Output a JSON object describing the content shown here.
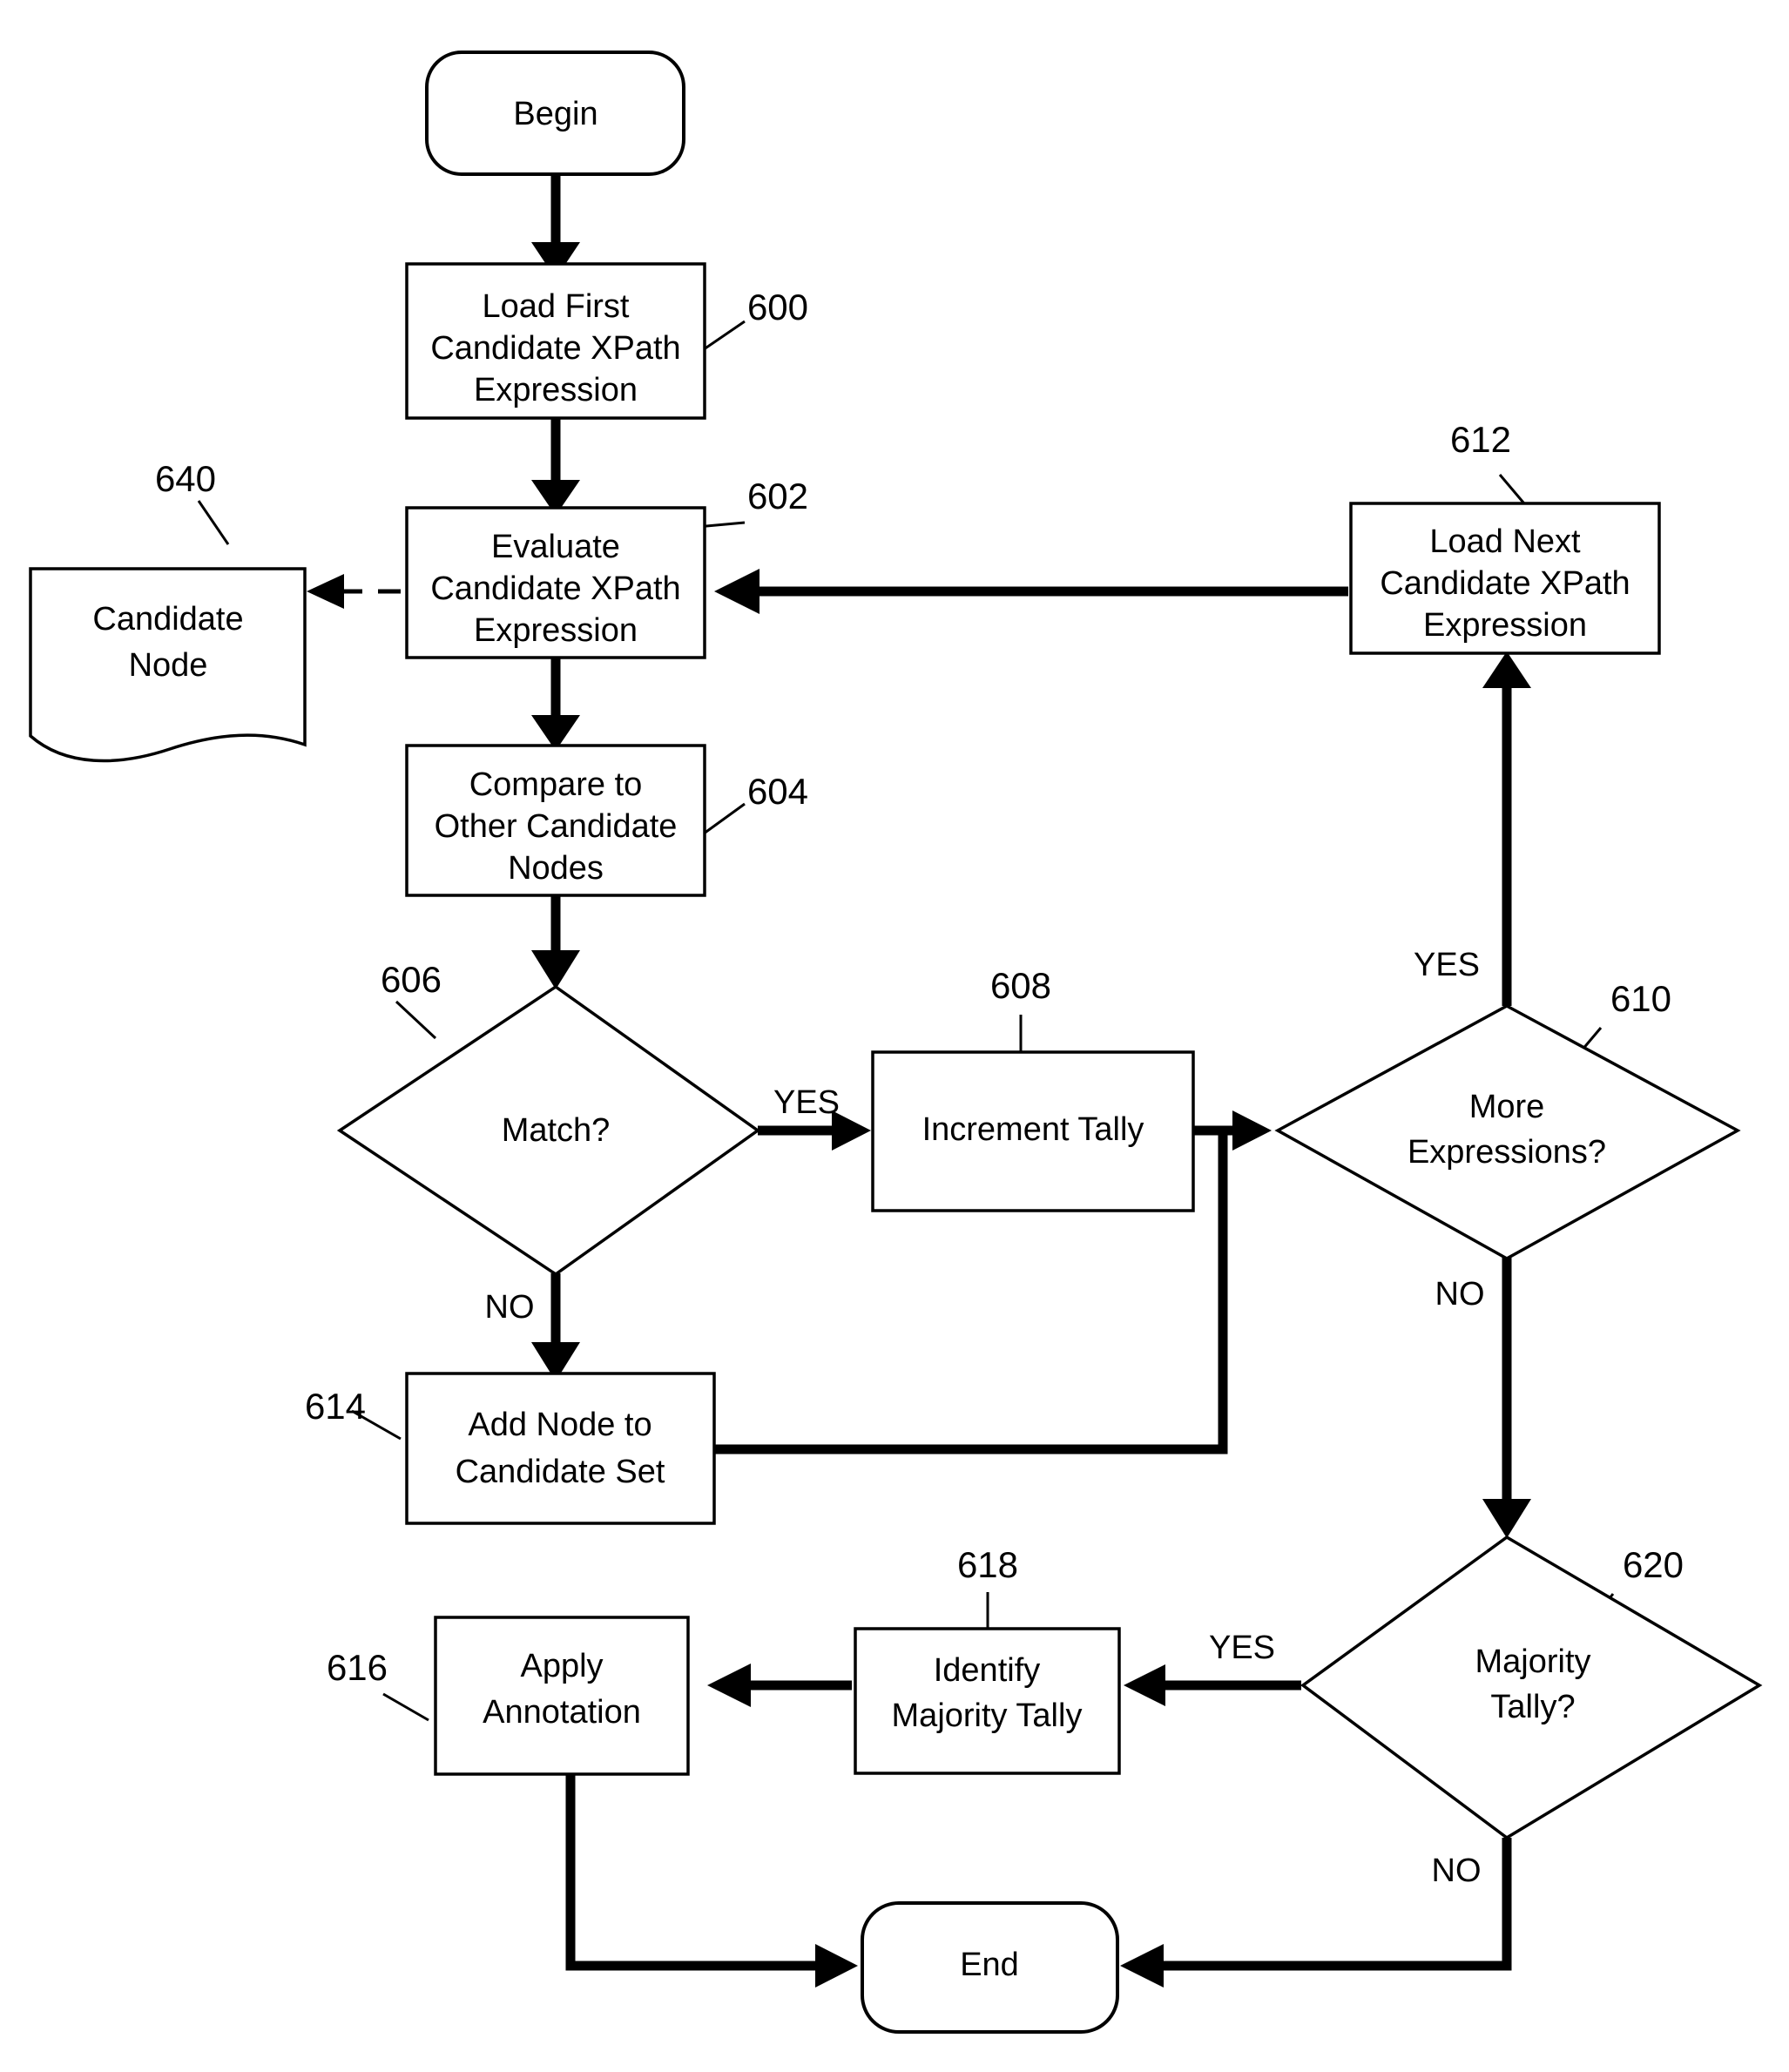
{
  "diagram": {
    "type": "flowchart",
    "title": "Candidate XPath Expression Evaluation Flowchart",
    "nodes": [
      {
        "id": "begin",
        "label": "Begin",
        "shape": "terminator",
        "ref": ""
      },
      {
        "id": "n600",
        "label_lines": [
          "Load First",
          "Candidate XPath",
          "Expression"
        ],
        "shape": "process",
        "ref": "600"
      },
      {
        "id": "n602",
        "label_lines": [
          "Evaluate",
          "Candidate XPath",
          "Expression"
        ],
        "shape": "process",
        "ref": "602"
      },
      {
        "id": "n640",
        "label_lines": [
          "Candidate",
          "Node"
        ],
        "shape": "document",
        "ref": "640"
      },
      {
        "id": "n604",
        "label_lines": [
          "Compare to",
          "Other Candidate",
          "Nodes"
        ],
        "shape": "process",
        "ref": "604"
      },
      {
        "id": "n606",
        "label_lines": [
          "Match?"
        ],
        "shape": "decision",
        "ref": "606"
      },
      {
        "id": "n608",
        "label_lines": [
          "Increment Tally"
        ],
        "shape": "process",
        "ref": "608"
      },
      {
        "id": "n610",
        "label_lines": [
          "More",
          "Expressions?"
        ],
        "shape": "decision",
        "ref": "610"
      },
      {
        "id": "n612",
        "label_lines": [
          "Load Next",
          "Candidate XPath",
          "Expression"
        ],
        "shape": "process",
        "ref": "612"
      },
      {
        "id": "n614",
        "label_lines": [
          "Add Node to",
          "Candidate Set"
        ],
        "shape": "process",
        "ref": "614"
      },
      {
        "id": "n616",
        "label_lines": [
          "Apply",
          "Annotation"
        ],
        "shape": "process",
        "ref": "616"
      },
      {
        "id": "n618",
        "label_lines": [
          "Identify",
          "Majority Tally"
        ],
        "shape": "process",
        "ref": "618"
      },
      {
        "id": "n620",
        "label_lines": [
          "Majority",
          "Tally?"
        ],
        "shape": "decision",
        "ref": "620"
      },
      {
        "id": "end",
        "label": "End",
        "shape": "terminator",
        "ref": ""
      }
    ],
    "edge_labels": {
      "match_yes": "YES",
      "match_no": "NO",
      "more_yes": "YES",
      "more_no": "NO",
      "majority_yes": "YES",
      "majority_no": "NO"
    },
    "reference_numerals": {
      "r600": "600",
      "r602": "602",
      "r604": "604",
      "r606": "606",
      "r608": "608",
      "r610": "610",
      "r612": "612",
      "r614": "614",
      "r616": "616",
      "r618": "618",
      "r620": "620",
      "r640": "640"
    },
    "node_text": {
      "begin": "Begin",
      "end": "End",
      "n600_l1": "Load First",
      "n600_l2": "Candidate XPath",
      "n600_l3": "Expression",
      "n602_l1": "Evaluate",
      "n602_l2": "Candidate XPath",
      "n602_l3": "Expression",
      "n640_l1": "Candidate",
      "n640_l2": "Node",
      "n604_l1": "Compare to",
      "n604_l2": "Other Candidate",
      "n604_l3": "Nodes",
      "n606_l1": "Match?",
      "n608_l1": "Increment Tally",
      "n610_l1": "More",
      "n610_l2": "Expressions?",
      "n612_l1": "Load Next",
      "n612_l2": "Candidate XPath",
      "n612_l3": "Expression",
      "n614_l1": "Add Node to",
      "n614_l2": "Candidate Set",
      "n616_l1": "Apply",
      "n616_l2": "Annotation",
      "n618_l1": "Identify",
      "n618_l2": "Majority Tally",
      "n620_l1": "Majority",
      "n620_l2": "Tally?"
    },
    "colors": {
      "ink": "#000000",
      "paper": "#ffffff"
    }
  }
}
